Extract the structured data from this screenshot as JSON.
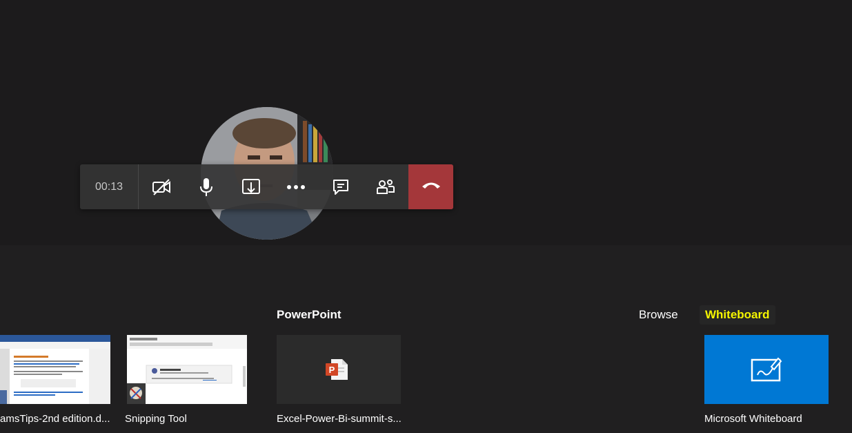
{
  "call": {
    "timer": "00:13",
    "controls": [
      "camera-off",
      "microphone",
      "share",
      "more-options",
      "chat",
      "participants",
      "hang-up"
    ]
  },
  "tray": {
    "powerpoint_title": "PowerPoint",
    "browse_label": "Browse",
    "whiteboard_label": "Whiteboard"
  },
  "windows": [
    {
      "label": "amsTips-2nd edition.d...",
      "icon": "word-document-thumbnail"
    },
    {
      "label": "Snipping Tool",
      "icon": "snipping-tool-thumbnail"
    }
  ],
  "powerpoint_files": [
    {
      "label": "Excel-Power-Bi-summit-s...",
      "icon": "powerpoint-file-icon"
    }
  ],
  "whiteboard": {
    "label": "Microsoft Whiteboard",
    "icon": "whiteboard-icon",
    "accent": "#0078d4"
  },
  "colors": {
    "hangup": "#a4373a",
    "whiteboard_highlight": "#f5f500"
  }
}
